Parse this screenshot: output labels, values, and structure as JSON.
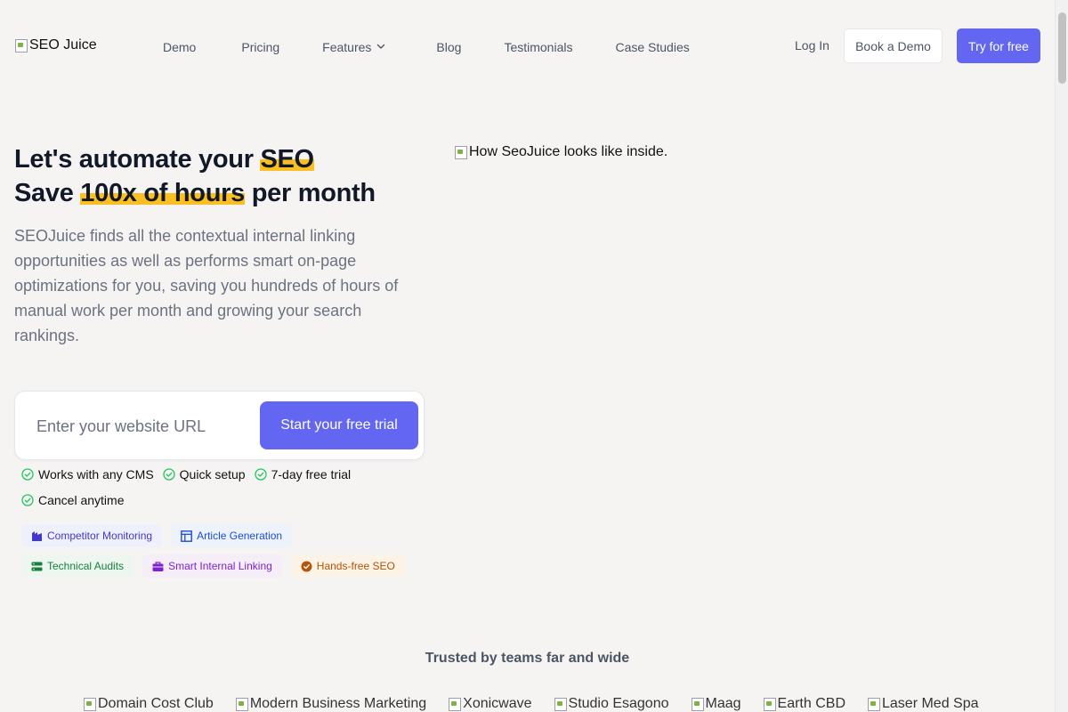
{
  "header": {
    "logo_alt": "SEO Juice",
    "nav": [
      {
        "label": "Demo"
      },
      {
        "label": "Pricing"
      },
      {
        "label": "Features"
      },
      {
        "label": "Blog"
      },
      {
        "label": "Testimonials"
      },
      {
        "label": "Case Studies"
      }
    ],
    "login_label": "Log In",
    "book_demo_label": "Book a Demo",
    "try_free_label": "Try for free"
  },
  "hero": {
    "title_line1_prefix": "Let's automate your ",
    "title_line1_highlight": "SEO",
    "title_line2_prefix": "Save ",
    "title_line2_highlight": "100x of hours",
    "title_line2_suffix": " per month",
    "description": "SEOJuice finds all the contextual internal linking opportunities as well as performs smart on-page optimizations for you, saving you hundreds of hours of manual work per month and growing your search rankings.",
    "image_alt": "How SeoJuice looks like inside.",
    "url_placeholder": "Enter your website URL",
    "url_value": "",
    "cta_label": "Start your free trial",
    "checks": [
      {
        "label": "Works with any CMS"
      },
      {
        "label": "Quick setup"
      },
      {
        "label": "7-day free trial"
      },
      {
        "label": "Cancel anytime"
      }
    ],
    "tags": [
      {
        "label": "Competitor Monitoring",
        "icon": "building-icon"
      },
      {
        "label": "Article Generation",
        "icon": "layout-icon"
      },
      {
        "label": "Technical Audits",
        "icon": "server-icon"
      },
      {
        "label": "Smart Internal Linking",
        "icon": "briefcase-icon"
      },
      {
        "label": "Hands-free SEO",
        "icon": "check-badge-icon"
      }
    ]
  },
  "trusted": {
    "heading": "Trusted by teams far and wide",
    "logos": [
      "Domain Cost Club",
      "Modern Business Marketing",
      "Xonicwave",
      "Studio Esagono",
      "Maag",
      "Earth CBD",
      "Laser Med Spa"
    ]
  },
  "colors": {
    "accent": "#6366f1",
    "highlight": "#fbbf24",
    "background": "#f5f4f3",
    "check_green": "#22c55e"
  }
}
